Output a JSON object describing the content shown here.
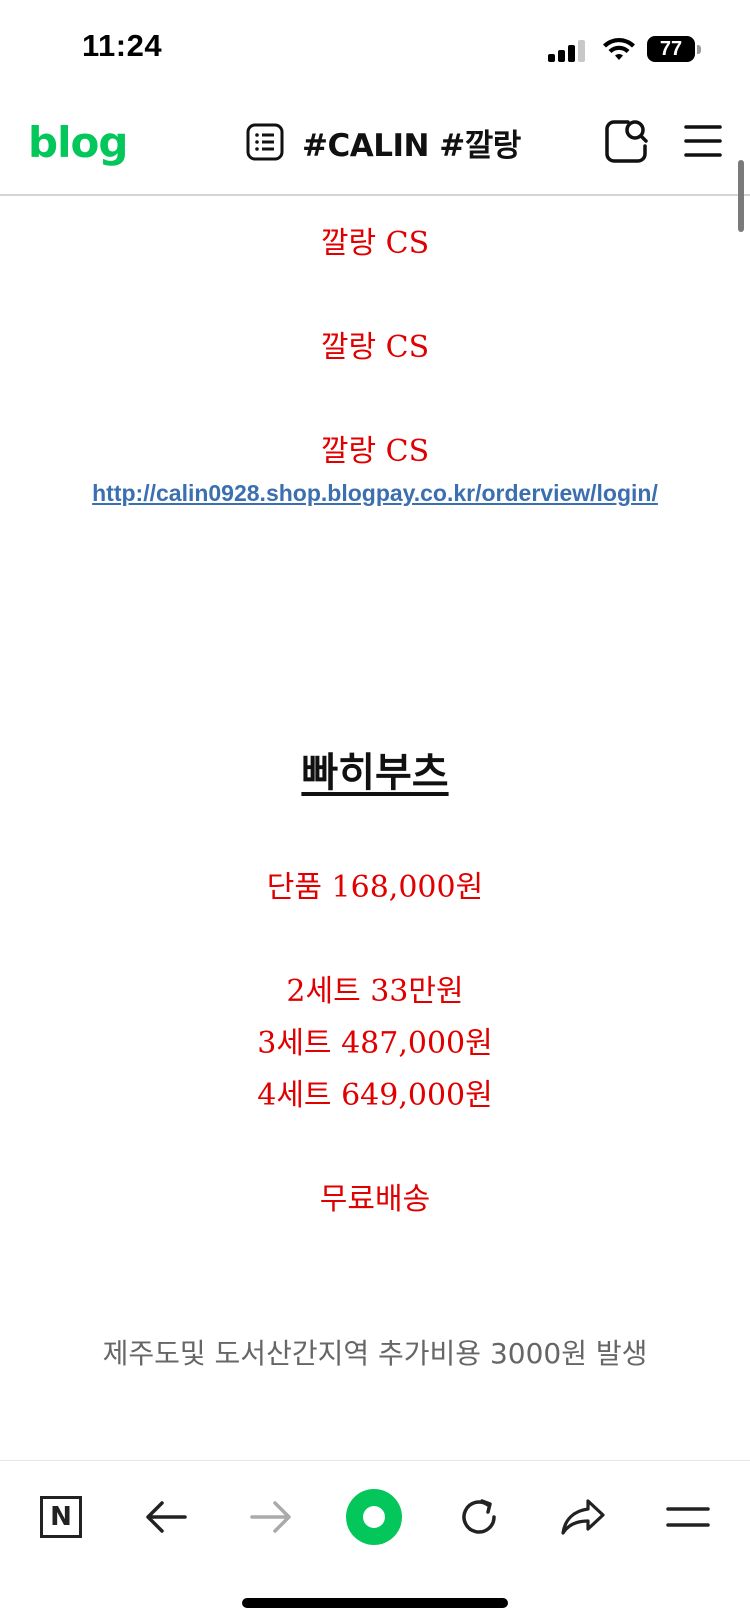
{
  "status_bar": {
    "time": "11:24",
    "battery": "77",
    "icons": [
      "cellular-signal-icon",
      "wifi-icon",
      "battery-icon"
    ]
  },
  "header": {
    "logo": "blog",
    "title": "#CALIN #깔랑",
    "icons": [
      "list-icon",
      "search-icon",
      "menu-icon"
    ]
  },
  "content": {
    "cs_lines": [
      "깔랑 CS",
      "깔랑 CS",
      "깔랑 CS"
    ],
    "link": "http://calin0928.shop.blogpay.co.kr/orderview/login/",
    "product_title": "빠히부츠",
    "prices": {
      "single": "단품 168,000원",
      "set2": "2세트 33만원",
      "set3": "3세트 487,000원",
      "set4": "4세트 649,000원"
    },
    "shipping": "무료배송",
    "note": "제주도및 도서산간지역 추가비용 3000원 발생"
  },
  "bottom_bar": {
    "n_label": "N",
    "icons": [
      "naver-home-icon",
      "back-arrow-icon",
      "forward-arrow-icon",
      "green-dot-icon",
      "refresh-icon",
      "share-icon",
      "menu-lines-icon"
    ]
  },
  "colors": {
    "brand_green": "#03c75a",
    "price_red": "#e00000",
    "link_blue": "#3b6fb0"
  }
}
